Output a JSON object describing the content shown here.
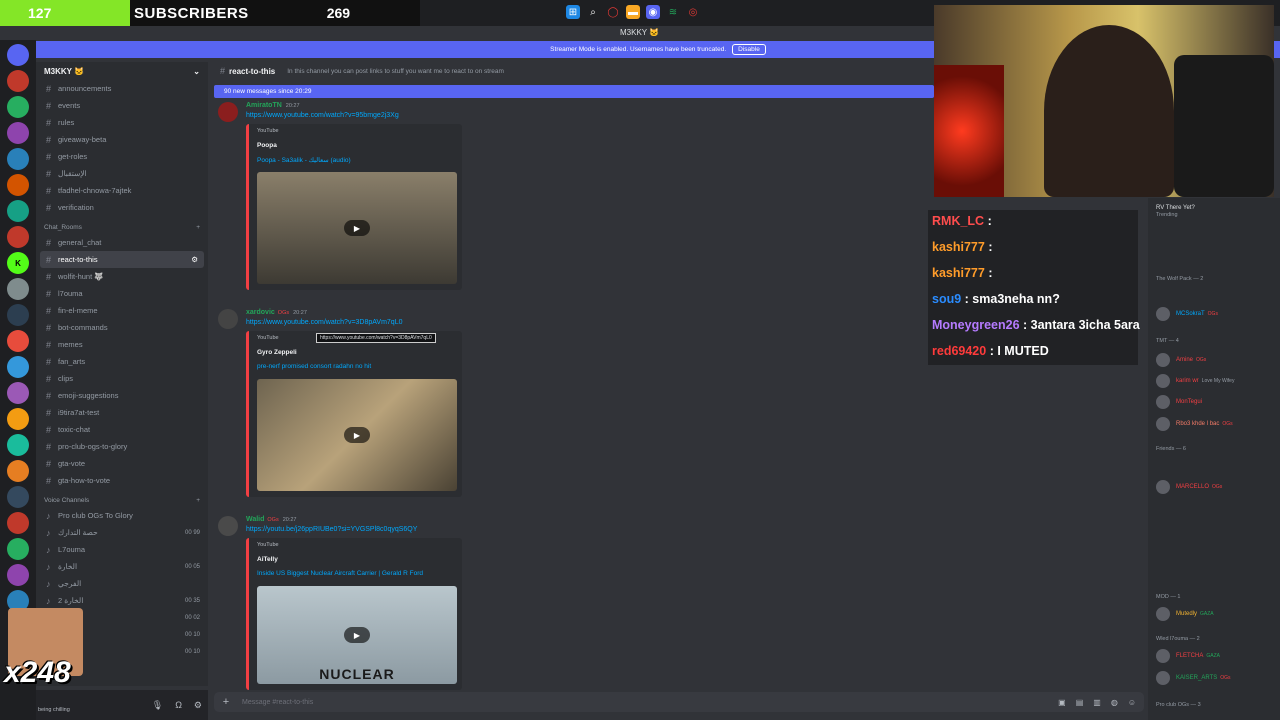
{
  "overlay": {
    "subscribers_count": "127",
    "subscribers_label": "SUBSCRIBERS",
    "subscribers_goal": "269",
    "multiplier": "x248"
  },
  "window": {
    "title": "M3KKY 🐱"
  },
  "streamer_banner": {
    "text": "Streamer Mode is enabled. Usernames have been truncated.",
    "button": "Disable"
  },
  "server": {
    "name": "M3KKY 🐱"
  },
  "sidebar": {
    "channels": [
      {
        "label": "announcements",
        "active": false
      },
      {
        "label": "events",
        "active": false
      },
      {
        "label": "rules",
        "active": false
      },
      {
        "label": "giveaway-beta",
        "active": false
      },
      {
        "label": "get-roles",
        "active": false
      },
      {
        "label": "الإستقبال",
        "active": false
      },
      {
        "label": "tfadhel-chnowa-7ajtek",
        "active": false
      },
      {
        "label": "verification",
        "active": false
      }
    ],
    "category_chat": "Chat_Rooms",
    "chat_channels": [
      {
        "label": "general_chat",
        "active": false
      },
      {
        "label": "react-to-this",
        "active": true
      },
      {
        "label": "wolfit-hunt 🐺",
        "active": false
      },
      {
        "label": "l7ouma",
        "active": false
      },
      {
        "label": "fin-el-meme",
        "active": false
      },
      {
        "label": "bot-commands",
        "active": false
      },
      {
        "label": "memes",
        "active": false
      },
      {
        "label": "fan_arts",
        "active": false
      },
      {
        "label": "clips",
        "active": false
      },
      {
        "label": "emoji-suggestions",
        "active": false
      },
      {
        "label": "i9tira7at-test",
        "active": false
      },
      {
        "label": "toxic-chat",
        "active": false
      },
      {
        "label": "pro-club-ogs-to-glory",
        "active": false
      },
      {
        "label": "gta-vote",
        "active": false
      },
      {
        "label": "gta-how-to-vote",
        "active": false
      }
    ],
    "category_voice": "Voice Channels",
    "voice_channels": [
      {
        "label": "Pro club OGs To Glory",
        "count": ""
      },
      {
        "label": "حصة التدارك",
        "count": "00 99"
      },
      {
        "label": "L7ouma",
        "count": ""
      },
      {
        "label": "الخارة",
        "count": "00 05"
      },
      {
        "label": "الفرجي",
        "count": ""
      },
      {
        "label": "الخارة 2",
        "count": "00 35"
      },
      {
        "label": "",
        "count": "00 02"
      },
      {
        "label": "",
        "count": "00 10"
      },
      {
        "label": "",
        "count": "00 10"
      }
    ]
  },
  "channel": {
    "name": "react-to-this",
    "topic": "In this channel you can post links to stuff you want me to react to on stream"
  },
  "new_messages_bar": "90 new messages since 20:29",
  "messages": [
    {
      "author": "AmiratoTN",
      "time": "20:27",
      "link": "https://www.youtube.com/watch?v=95bmge2j3Xg",
      "embed_site": "YouTube",
      "embed_author": "Poopa",
      "embed_title": "Poopa - Sa3alik - سعاليك (audio)"
    },
    {
      "author": "xardovic",
      "badge": "OGs",
      "time": "20:27",
      "link": "https://www.youtube.com/watch?v=3D8pAVm7qL0",
      "embed_site": "YouTube",
      "embed_author": "Gyro Zeppeli",
      "embed_title": "pre-nerf promised consort radahn no hit"
    },
    {
      "author": "Walid",
      "badge": "OGs",
      "time": "20:27",
      "link": "https://youtu.be/j26ppRIUBe0?si=YVGSPl8c0qyqS6QY",
      "embed_site": "YouTube",
      "embed_author": "AiTelly",
      "embed_title": "Inside US Biggest Nuclear Aircraft Carrier | Gerald R Ford",
      "thumb_text": "NUCLEAR"
    }
  ],
  "tooltip": "https://www.youtube.com/watch?v=3D8pAVm7qL0",
  "composer": {
    "placeholder": "Message #react-to-this"
  },
  "user_panel": {
    "status": "being chilling"
  },
  "stream_chat": [
    {
      "user": "RMK_LC",
      "msg": ":",
      "color": "#ff4d4d"
    },
    {
      "user": "kashi777",
      "msg": ":",
      "color": "#ff9c2a"
    },
    {
      "user": "kashi777",
      "msg": ":",
      "color": "#ff9c2a"
    },
    {
      "user": "sou9",
      "msg": ": sma3neha nn?",
      "color": "#2a8cff"
    },
    {
      "user": "Moneygreen26",
      "msg": ": 3antara 3icha 5ara",
      "color": "#b57bff"
    },
    {
      "user": "red69420",
      "msg": ": I MUTED",
      "color": "#ff3b3b"
    }
  ],
  "member_list": {
    "activity": "RV There Yet?",
    "activity_sub": "Trending",
    "groups": [
      {
        "label": "The Wolf Pack — 2"
      },
      {
        "label": "TMT — 4"
      },
      {
        "label": "Friends — 6"
      },
      {
        "label": "MOD — 1"
      },
      {
        "label": "Wled l7ouma — 2"
      },
      {
        "label": "Pro club OGs — 3"
      }
    ],
    "members": [
      {
        "name": "MCSokraT",
        "color": "#00a8fc",
        "tag": "OGs"
      },
      {
        "name": "Amine",
        "color": "#f23f43",
        "tag": "OGs"
      },
      {
        "name": "karim wr",
        "color": "#f23f43",
        "sub": "Love My Wifey"
      },
      {
        "name": "MonTegui",
        "color": "#f23f43"
      },
      {
        "name": "Rbo3 khde l bac",
        "color": "#f47b67",
        "tag": "OGs"
      },
      {
        "name": "MARCELLO",
        "color": "#f23f43",
        "tag": "OGs"
      },
      {
        "name": "Mutedly",
        "color": "#f0b232",
        "tag": "GAZA"
      },
      {
        "name": "FLETCHA",
        "color": "#f23f43",
        "tag": "GAZA"
      },
      {
        "name": "KAISER_ARTS",
        "color": "#23a55a",
        "tag": "OGs"
      }
    ]
  }
}
